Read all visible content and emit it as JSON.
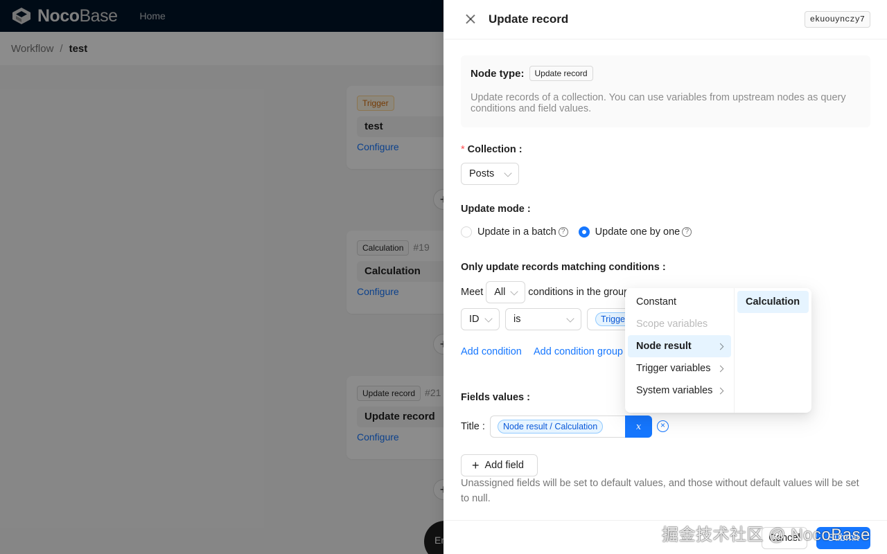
{
  "app": {
    "logo_primary": "Noco",
    "logo_secondary": "Base",
    "nav_home": "Home"
  },
  "breadcrumb": {
    "parent": "Workflow",
    "separator": "/",
    "current": "test"
  },
  "canvas": {
    "nodes": [
      {
        "tag": "Trigger",
        "id": "",
        "title": "test",
        "action": "Configure"
      },
      {
        "tag": "Calculation",
        "id": "#19",
        "title": "Calculation",
        "action": "Configure"
      },
      {
        "tag": "Update record",
        "id": "#21",
        "title": "Update record",
        "action": "Configure"
      }
    ],
    "add_symbol": "+",
    "end_label": "End"
  },
  "drawer": {
    "title": "Update record",
    "node_key": "ekuouynczy7",
    "node_type_label": "Node type:",
    "node_type_value": "Update record",
    "description": "Update records of a collection. You can use variables from upstream nodes as query conditions and field values.",
    "collection": {
      "required_mark": "*",
      "label": "Collection",
      "value": "Posts"
    },
    "update_mode": {
      "label": "Update mode",
      "options": [
        {
          "label": "Update in a batch",
          "checked": false
        },
        {
          "label": "Update one by one",
          "checked": true
        }
      ],
      "help_symbol": "?"
    },
    "conditions": {
      "label": "Only update records matching conditions",
      "meet_prefix": "Meet",
      "meet_value": "All",
      "meet_suffix": "conditions in the group",
      "field": "ID",
      "operator": "is",
      "value_tag": "Trigger",
      "add_condition": "Add condition",
      "add_condition_group": "Add condition group"
    },
    "fields_values": {
      "label": "Fields values",
      "title_label": "Title",
      "title_value_tag": "Node result / Calculation",
      "variable_button": "x",
      "clear_symbol": "×",
      "add_field": "Add field",
      "add_symbol": "+",
      "note": "Unassigned fields will be set to default values, and those without default values will be set to null."
    },
    "footer": {
      "cancel": "Cancel",
      "submit": "Submit"
    },
    "watermark": "掘金技术社区 @ NocoBase"
  },
  "cascader": {
    "column1": [
      {
        "label": "Constant",
        "state": "normal",
        "has_children": false
      },
      {
        "label": "Scope variables",
        "state": "disabled",
        "has_children": false
      },
      {
        "label": "Node result",
        "state": "active",
        "has_children": true
      },
      {
        "label": "Trigger variables",
        "state": "normal",
        "has_children": true
      },
      {
        "label": "System variables",
        "state": "normal",
        "has_children": true
      }
    ],
    "column2": [
      {
        "label": "Calculation",
        "state": "active"
      }
    ]
  },
  "colors": {
    "primary": "#1677ff",
    "header_bg": "#001529",
    "trigger_tag": "#d46b08",
    "required": "#ff4d4f"
  }
}
